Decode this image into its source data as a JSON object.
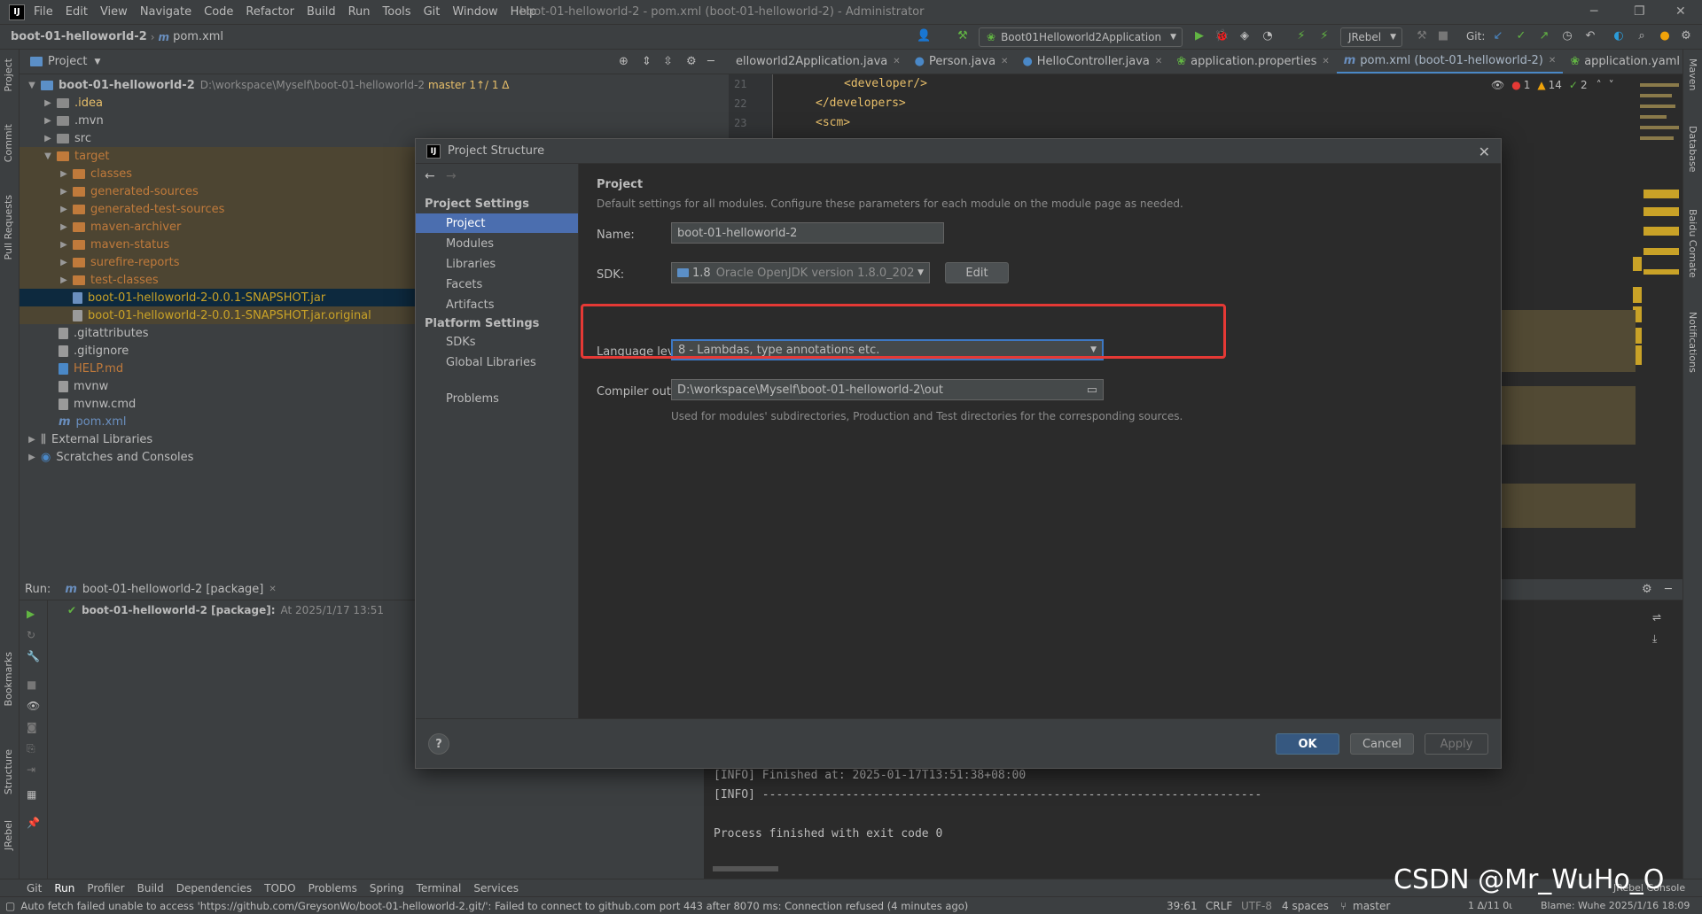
{
  "window": {
    "menu": [
      "File",
      "Edit",
      "View",
      "Navigate",
      "Code",
      "Refactor",
      "Build",
      "Run",
      "Tools",
      "Git",
      "Window",
      "Help"
    ],
    "title": "boot-01-helloworld-2 - pom.xml (boot-01-helloworld-2) - Administrator"
  },
  "navbar": {
    "project": "boot-01-helloworld-2",
    "file": "pom.xml",
    "run_config": "Boot01Helloworld2Application",
    "jrebel": "JRebel",
    "git_label": "Git:"
  },
  "left_strip": [
    "Project",
    "Commit",
    "Pull Requests",
    "Bookmarks",
    "Structure",
    "JRebel"
  ],
  "right_strip": [
    "Maven",
    "Database",
    "Baidu Comate",
    "Notifications"
  ],
  "project_panel": {
    "title": "Project",
    "root_name": "boot-01-helloworld-2",
    "root_path": "D:\\workspace\\Myself\\boot-01-helloworld-2",
    "root_branch": "master",
    "root_changes": "1↑/ 1 Δ",
    "items": [
      {
        "label": ".idea"
      },
      {
        "label": ".mvn"
      },
      {
        "label": "src"
      },
      {
        "label": "target"
      },
      {
        "label": "classes"
      },
      {
        "label": "generated-sources"
      },
      {
        "label": "generated-test-sources"
      },
      {
        "label": "maven-archiver"
      },
      {
        "label": "maven-status"
      },
      {
        "label": "surefire-reports"
      },
      {
        "label": "test-classes"
      },
      {
        "label": "boot-01-helloworld-2-0.0.1-SNAPSHOT.jar"
      },
      {
        "label": "boot-01-helloworld-2-0.0.1-SNAPSHOT.jar.original"
      },
      {
        "label": ".gitattributes"
      },
      {
        "label": ".gitignore"
      },
      {
        "label": "HELP.md"
      },
      {
        "label": "mvnw"
      },
      {
        "label": "mvnw.cmd"
      },
      {
        "label": "pom.xml"
      },
      {
        "label": "External Libraries"
      },
      {
        "label": "Scratches and Consoles"
      }
    ]
  },
  "editor": {
    "tabs": [
      "elloworld2Application.java",
      "Person.java",
      "HelloController.java",
      "application.properties",
      "pom.xml (boot-01-helloworld-2)",
      "application.yaml"
    ],
    "lines": [
      {
        "num": "21",
        "text": "<developer/>"
      },
      {
        "num": "22",
        "text": "</developers>"
      },
      {
        "num": "23",
        "text": "<scm>"
      }
    ],
    "inspections": {
      "errors": "1",
      "warnings": "14",
      "ok": "2"
    }
  },
  "run_panel": {
    "label": "Run:",
    "tab": "boot-01-helloworld-2 [package]",
    "result_name": "boot-01-helloworld-2 [package]:",
    "result_time": "At 2025/1/17 13:51",
    "console": [
      "[INFO] Finished at: 2025-01-17T13:51:38+08:00",
      "[INFO] ------------------------------------------------------------------------",
      "Process finished with exit code 0"
    ]
  },
  "dialog": {
    "title": "Project Structure",
    "nav": {
      "project_settings": "Project Settings",
      "items1": [
        "Project",
        "Modules",
        "Libraries",
        "Facets",
        "Artifacts"
      ],
      "platform_settings": "Platform Settings",
      "items2": [
        "SDKs",
        "Global Libraries"
      ],
      "problems": "Problems"
    },
    "content": {
      "heading": "Project",
      "description": "Default settings for all modules. Configure these parameters for each module on the module page as needed.",
      "name_label": "Name:",
      "name_value": "boot-01-helloworld-2",
      "sdk_label": "SDK:",
      "sdk_version": "1.8",
      "sdk_value": "Oracle OpenJDK version 1.8.0_202",
      "edit": "Edit",
      "lang_label": "Language level:",
      "lang_value": "8 - Lambdas, type annotations etc.",
      "compiler_label": "Compiler output:",
      "compiler_value": "D:\\workspace\\Myself\\boot-01-helloworld-2\\out",
      "compiler_hint": "Used for modules' subdirectories, Production and Test directories for the corresponding sources."
    },
    "buttons": {
      "help": "?",
      "ok": "OK",
      "cancel": "Cancel",
      "apply": "Apply"
    }
  },
  "bottom_tools": [
    "Git",
    "Run",
    "Profiler",
    "Build",
    "Dependencies",
    "TODO",
    "Problems",
    "Spring",
    "Terminal",
    "Services"
  ],
  "status": {
    "message": "Auto fetch failed unable to access 'https://github.com/GreysonWo/boot-01-helloworld-2.git/': Failed to connect to github.com port 443 after 8070 ms: Connection refused (4 minutes ago)",
    "position": "39:61",
    "line_sep": "CRLF",
    "encoding": "UTF-8",
    "indent": "4 spaces",
    "branch": "master",
    "changes": "1 Δ/11 0ι",
    "blame": "Blame: Wuhe 2025/1/16 18:09",
    "rebel_console": "JRebel Console"
  },
  "watermark": "CSDN @Mr_WuHo_O",
  "colors": {
    "accent": "#4b6eaf",
    "highlight": "#e53935",
    "primary_btn": "#365880"
  }
}
